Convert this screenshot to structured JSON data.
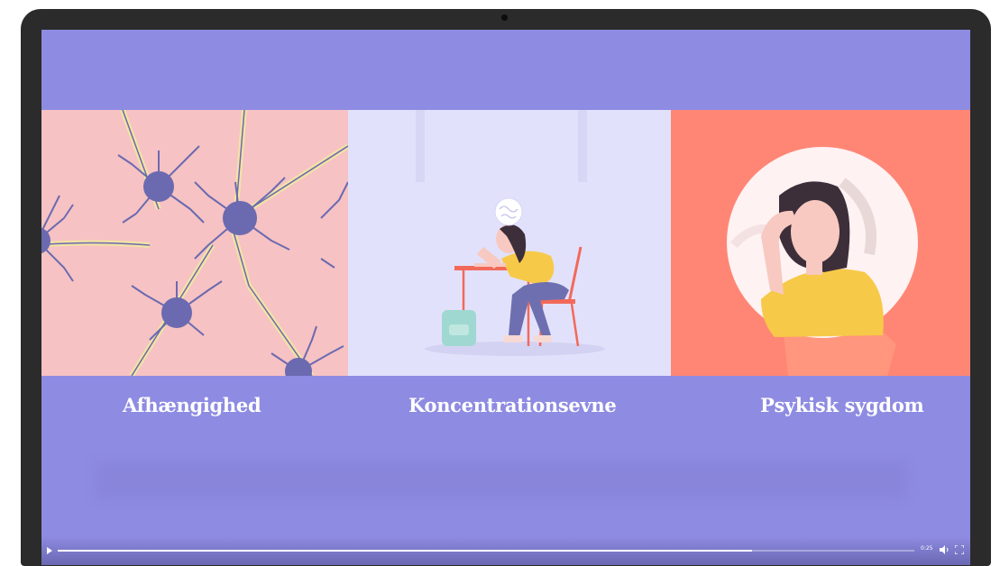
{
  "video": {
    "time": "0:25",
    "progress": 0.81
  },
  "cards": [
    {
      "label": "Afhængighed"
    },
    {
      "label": "Koncentrationsevne"
    },
    {
      "label": "Psykisk sygdom"
    }
  ],
  "colors": {
    "background": "#8e8be2",
    "card1": "#f6c2c3",
    "card2": "#e2e1fb",
    "card3": "#ff8675"
  },
  "icons": [
    "play-icon",
    "volume-icon",
    "fullscreen-icon"
  ]
}
